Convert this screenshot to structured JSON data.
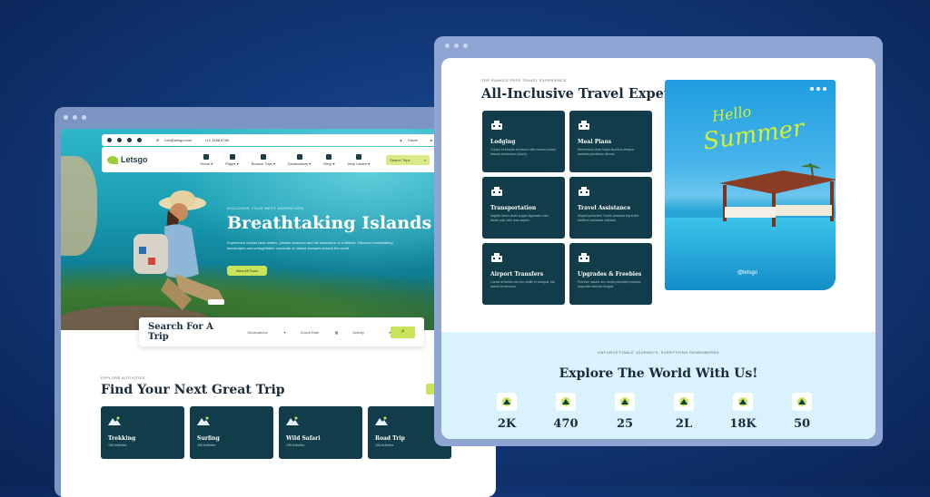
{
  "left_window": {
    "topbar": {
      "email": "info@letsgo.com",
      "phone": "+12 3456 6789",
      "right_text": "Travel"
    },
    "logo": "Letsgo",
    "nav": [
      {
        "label": "Home ▾",
        "icon": "home-icon"
      },
      {
        "label": "Pages ▾",
        "icon": "pages-icon"
      },
      {
        "label": "Browse Trips ▾",
        "icon": "map-pin-icon"
      },
      {
        "label": "Destinations ▾",
        "icon": "bus-icon"
      },
      {
        "label": "Shop ▾",
        "icon": "cart-icon"
      },
      {
        "label": "Help Centre ▾",
        "icon": "phone-icon"
      }
    ],
    "nav_search_label": "Search Trips",
    "hero": {
      "kicker": "DISCOVER YOUR NEXT ADVENTURE",
      "title": "Breathtaking Islands",
      "text": "Experience crystal clear waters, pristine beaches and the adventure of a lifetime. Discover breathtaking landscapes and unforgettable moments on island escapes around the world.",
      "button": "View All Tours"
    },
    "search": {
      "title": "Search For A Trip",
      "destination": "Destinations",
      "date": "Check Date",
      "activity": "Activity"
    },
    "section": {
      "kicker": "EXPLORE ACTIVITIES",
      "title": "Find Your Next Great Trip"
    },
    "trips": [
      {
        "title": "Trekking",
        "sub": "155 Activities",
        "icon": "trekking-icon"
      },
      {
        "title": "Surfing",
        "sub": "155 Activities",
        "icon": "surfing-icon"
      },
      {
        "title": "Wild Safari",
        "sub": "155 Activities",
        "icon": "safari-icon"
      },
      {
        "title": "Road Trip",
        "sub": "155 Activities",
        "icon": "road-trip-icon"
      }
    ]
  },
  "right_window": {
    "kicker": "TOP RANKED FREE TRAVEL EXPERIENCE",
    "title": "All-Inclusive Travel Experience",
    "features": [
      {
        "title": "Lodging",
        "desc": "Cursus id lobortis est lacus nibh massa ornare. Mauris elementum (auch).",
        "icon": "hotel-icon"
      },
      {
        "title": "Meal Plans",
        "desc": "Elementum vitae turpis faucibus tempus habitant penatibus ultrices.",
        "icon": "meal-icon"
      },
      {
        "title": "Transportation",
        "desc": "Sagittis libero amet augue dignissim odio. Morbi odio nibh duis sapien.",
        "icon": "transport-icon"
      },
      {
        "title": "Travel Assistance",
        "desc": "Aliquet parturient. Sociis pharetra imperdiet eleifend habitasse habitant.",
        "icon": "assistance-icon"
      },
      {
        "title": "Airport Transfers",
        "desc": "Luctus at fames nec dui mollis et volutpat. Ma lacinia fermentum.",
        "icon": "plane-icon"
      },
      {
        "title": "Upgrades & Freebies",
        "desc": "Pulvinar mauris nec morbi parturient pulvinar. Imperdiet ultricies feugiat.",
        "icon": "gift-icon"
      }
    ],
    "photo": {
      "hello": "Hello",
      "summer": "Summer",
      "brand": "@letsgo"
    },
    "explore": {
      "kicker": "UNFORGETTABLE JOURNEYS, EVERYTHING REMEMBERED",
      "title": "Explore The World With Us!",
      "stats": [
        {
          "value": "2K",
          "icon": "globe-icon"
        },
        {
          "value": "470",
          "icon": "tent-icon"
        },
        {
          "value": "25",
          "icon": "city-icon"
        },
        {
          "value": "2L",
          "icon": "satellite-icon"
        },
        {
          "value": "18K",
          "icon": "telescope-icon"
        },
        {
          "value": "50",
          "icon": "scenery-icon"
        }
      ]
    }
  },
  "colors": {
    "background": "#12397a",
    "card": "#113c4a",
    "accent": "#c9e45a",
    "explore_bg": "#daf2fb"
  }
}
